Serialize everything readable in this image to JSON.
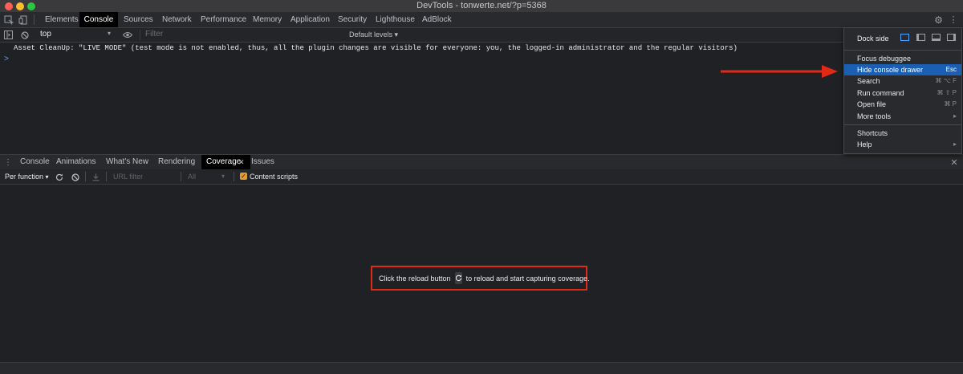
{
  "window": {
    "title": "DevTools - tonwerte.net/?p=5368"
  },
  "colors": {
    "accent": "#1a5fb4",
    "highlight_box": "#e02a17",
    "checkbox": "#e39b2a",
    "arrow": "#e02a17"
  },
  "main_tabs": [
    "Elements",
    "Console",
    "Sources",
    "Network",
    "Performance",
    "Memory",
    "Application",
    "Security",
    "Lighthouse",
    "AdBlock"
  ],
  "console_toolbar": {
    "context": "top",
    "filter_placeholder": "Filter",
    "levels": "Default levels"
  },
  "console": {
    "message": "Asset CleanUp: \"LIVE MODE\" (test mode is not enabled, thus, all the plugin changes are visible for everyone: you, the logged-in administrator and the regular visitors)",
    "prompt": ">"
  },
  "drawer": {
    "tabs": [
      "Console",
      "Animations",
      "What's New",
      "Rendering",
      "Coverage",
      "Issues"
    ],
    "active_tab": "Coverage"
  },
  "coverage": {
    "mode": "Per function",
    "url_filter_placeholder": "URL filter",
    "type_filter": "All",
    "content_scripts": "Content scripts",
    "content_scripts_checked": true,
    "empty_before": "Click the reload button",
    "empty_after": "to reload and start capturing coverage."
  },
  "menu": {
    "dock_side": "Dock side",
    "items": [
      {
        "label": "Focus debuggee",
        "shortcut": ""
      },
      {
        "label": "Hide console drawer",
        "shortcut": "Esc"
      },
      {
        "label": "Search",
        "shortcut": "⌘ ⌥ F"
      },
      {
        "label": "Run command",
        "shortcut": "⌘ ⇧ P"
      },
      {
        "label": "Open file",
        "shortcut": "⌘ P"
      },
      {
        "label": "More tools",
        "shortcut": "▸"
      },
      {
        "label": "Shortcuts",
        "shortcut": ""
      },
      {
        "label": "Help",
        "shortcut": "▸"
      }
    ]
  }
}
